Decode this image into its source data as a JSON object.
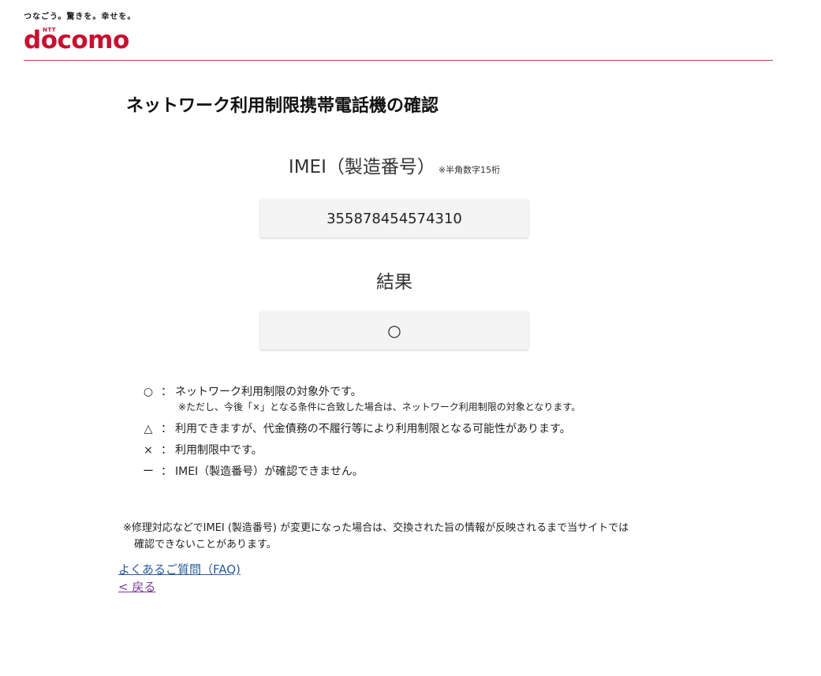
{
  "header": {
    "tagline": "つなごう。驚きを。幸せを。",
    "logo_text": "docomo",
    "logo_ntt": "NTT",
    "brand_color": "#c8102e"
  },
  "page": {
    "title": "ネットワーク利用制限携帯電話機の確認"
  },
  "imei": {
    "label": "IMEI（製造番号）",
    "note": "※半角数字15桁",
    "value": "355878454574310"
  },
  "result": {
    "label": "結果",
    "value": "○"
  },
  "legend": [
    {
      "symbol": "○",
      "colon": "：",
      "text": "ネットワーク利用制限の対象外です。",
      "sub": "※ただし、今後「×」となる条件に合致した場合は、ネットワーク利用制限の対象となります。"
    },
    {
      "symbol": "△",
      "colon": "：",
      "text": "利用できますが、代金債務の不履行等により利用制限となる可能性があります。"
    },
    {
      "symbol": "×",
      "colon": "：",
      "text": "利用制限中です。"
    },
    {
      "symbol": "ー",
      "colon": "：",
      "text": "IMEI（製造番号）が確認できません。"
    }
  ],
  "note": {
    "line1": "※修理対応などでIMEI (製造番号) が変更になった場合は、交換された旨の情報が反映されるまで当サイトでは",
    "line2": "確認できないことがあります。"
  },
  "links": {
    "faq": "よくあるご質問（FAQ)",
    "back": "< 戻る"
  }
}
